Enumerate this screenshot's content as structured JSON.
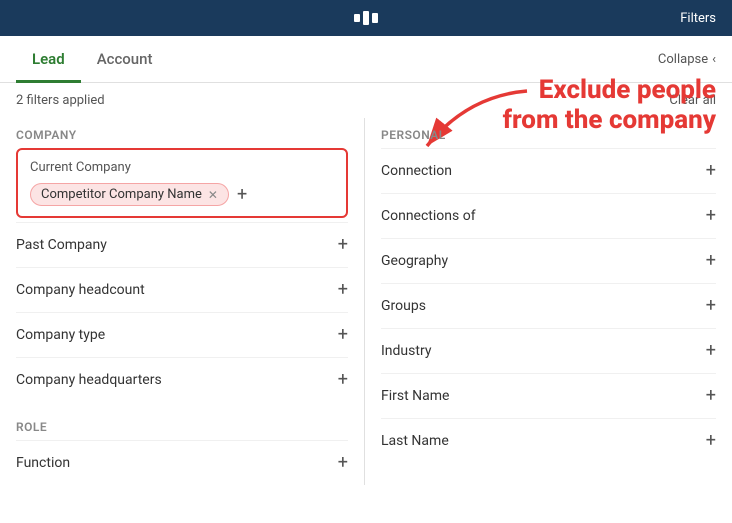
{
  "topBar": {
    "logoAlt": "LinkedIn logo",
    "rightText": "Filters"
  },
  "tabs": [
    {
      "id": "lead",
      "label": "Lead",
      "active": true
    },
    {
      "id": "account",
      "label": "Account",
      "active": false
    }
  ],
  "collapseButton": {
    "label": "Collapse"
  },
  "annotation": {
    "line1": "Exclude people",
    "line2": "from the company"
  },
  "filtersBar": {
    "filtersApplied": "2 filters applied",
    "clearAll": "Clear all"
  },
  "leftColumn": {
    "sections": [
      {
        "id": "company",
        "label": "Company",
        "items": [
          {
            "id": "current-company",
            "label": "Current Company",
            "highlighted": true,
            "tags": [
              {
                "text": "Competitor Company Name",
                "removable": true
              }
            ]
          },
          {
            "id": "past-company",
            "label": "Past Company",
            "hasPlus": true
          },
          {
            "id": "company-headcount",
            "label": "Company headcount",
            "hasPlus": true
          },
          {
            "id": "company-type",
            "label": "Company type",
            "hasPlus": true
          },
          {
            "id": "company-headquarters",
            "label": "Company headquarters",
            "hasPlus": true
          }
        ]
      },
      {
        "id": "role",
        "label": "Role",
        "items": [
          {
            "id": "function",
            "label": "Function",
            "hasPlus": true
          }
        ]
      }
    ]
  },
  "rightColumn": {
    "sections": [
      {
        "id": "personal",
        "label": "Personal",
        "items": [
          {
            "id": "connection",
            "label": "Connection",
            "hasPlus": true
          },
          {
            "id": "connections-of",
            "label": "Connections of",
            "hasPlus": true
          },
          {
            "id": "geography",
            "label": "Geography",
            "hasPlus": true
          },
          {
            "id": "groups",
            "label": "Groups",
            "hasPlus": true
          },
          {
            "id": "industry",
            "label": "Industry",
            "hasPlus": true
          },
          {
            "id": "first-name",
            "label": "First Name",
            "hasPlus": true
          },
          {
            "id": "last-name",
            "label": "Last Name",
            "hasPlus": true
          }
        ]
      }
    ]
  }
}
